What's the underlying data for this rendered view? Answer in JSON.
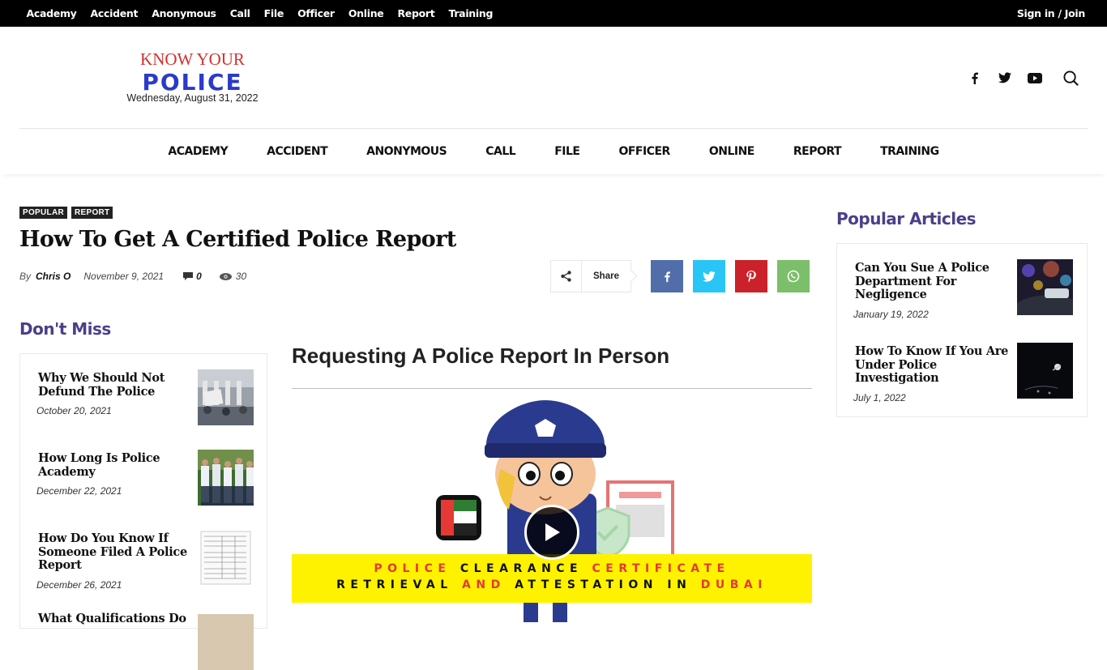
{
  "topbar": {
    "links": [
      "Academy",
      "Accident",
      "Anonymous",
      "Call",
      "File",
      "Officer",
      "Online",
      "Report",
      "Training"
    ],
    "signin": "Sign in / Join"
  },
  "logo": {
    "top": "KNOW YOUR",
    "main": "POLICE",
    "date": "Wednesday, August 31, 2022"
  },
  "header_icons": [
    "facebook-icon",
    "twitter-icon",
    "youtube-icon",
    "search-icon"
  ],
  "mainnav": [
    "ACADEMY",
    "ACCIDENT",
    "ANONYMOUS",
    "CALL",
    "FILE",
    "OFFICER",
    "ONLINE",
    "REPORT",
    "TRAINING"
  ],
  "article": {
    "tags": [
      "POPULAR",
      "REPORT"
    ],
    "title": "How To Get A Certified Police Report",
    "by": "By",
    "author": "Chris O",
    "date": "November 9, 2021",
    "comments": "0",
    "views": "30",
    "share_label": "Share",
    "subheading": "Requesting A Police Report In Person",
    "video_banner_line1": [
      "POLICE",
      "CLEARANCE",
      "CERTIFICATE"
    ],
    "video_banner_line2": [
      "RETRIEVAL",
      "AND",
      "ATTESTATION",
      "IN",
      "DUBAI"
    ]
  },
  "share_buttons": [
    {
      "icon": "facebook-icon",
      "color": "#516eab"
    },
    {
      "icon": "twitter-icon",
      "color": "#29c5f6"
    },
    {
      "icon": "pinterest-icon",
      "color": "#ca212a"
    },
    {
      "icon": "whatsapp-icon",
      "color": "#7bbf6a"
    }
  ],
  "dont_miss": {
    "heading": "Don't Miss",
    "items": [
      {
        "title": "Why We Should Not Defund The Police",
        "date": "October 20, 2021"
      },
      {
        "title": "How Long Is Police Academy",
        "date": "December 22, 2021"
      },
      {
        "title": "How Do You Know If Someone Filed A Police Report",
        "date": "December 26, 2021"
      },
      {
        "title": "What Qualifications Do",
        "date": ""
      }
    ]
  },
  "popular": {
    "heading": "Popular Articles",
    "items": [
      {
        "title": "Can You Sue A Police Department For Negligence",
        "date": "January 19, 2022"
      },
      {
        "title": "How To Know If You Are Under Police Investigation",
        "date": "July 1, 2022"
      }
    ]
  },
  "colors": {
    "section_heading": "#4b3f8a",
    "logo_red": "#d32f2f",
    "logo_blue": "#2a3bc9",
    "banner_yellow": "#fff200"
  }
}
